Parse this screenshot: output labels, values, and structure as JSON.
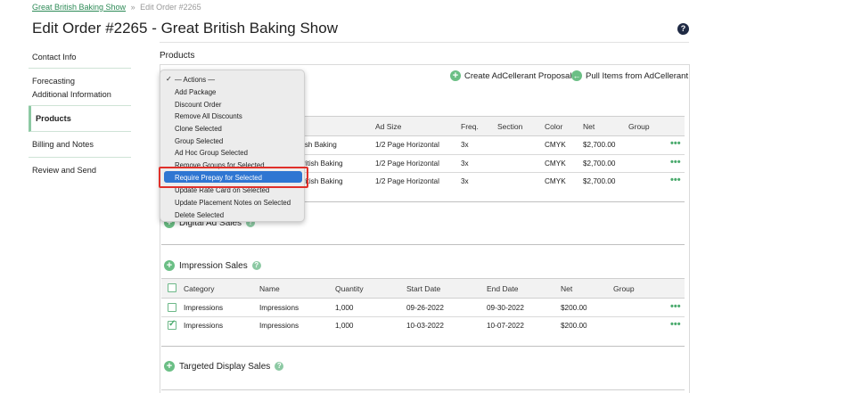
{
  "breadcrumb": {
    "link": "Great British Baking Show",
    "separator": "»",
    "current": "Edit Order #2265"
  },
  "page_title": "Edit Order #2265 - Great British Baking Show",
  "help_label": "?",
  "sidebar": {
    "items": [
      {
        "label": "Contact Info"
      },
      {
        "label": "Forecasting"
      },
      {
        "label": "Additional Information"
      },
      {
        "label": "Products"
      },
      {
        "label": "Billing and Notes"
      },
      {
        "label": "Review and Send"
      }
    ]
  },
  "products_heading": "Products",
  "top_actions": {
    "create_proposal": "Create AdCellerant Proposal",
    "pull_items": "Pull Items from AdCellerant"
  },
  "print_table": {
    "headers": [
      "Ad Size",
      "Freq.",
      "Section",
      "Color",
      "Net",
      "Group"
    ],
    "rows": [
      {
        "name_fragment": "ish Baking",
        "ad_size": "1/2 Page Horizontal",
        "freq": "3x",
        "section": "",
        "color": "CMYK",
        "net": "$2,700.00"
      },
      {
        "name_fragment": "ritish Baking",
        "ad_size": "1/2 Page Horizontal",
        "freq": "3x",
        "section": "",
        "color": "CMYK",
        "net": "$2,700.00"
      },
      {
        "name_fragment": "ritish Baking",
        "ad_size": "1/2 Page Horizontal",
        "freq": "3x",
        "section": "",
        "color": "CMYK",
        "net": "$2,700.00"
      }
    ]
  },
  "digital_section_title": "Digital Ad Sales",
  "impression_section": {
    "title": "Impression Sales",
    "headers": [
      "Category",
      "Name",
      "Quantity",
      "Start Date",
      "End Date",
      "Net",
      "Group"
    ],
    "rows": [
      {
        "checked": false,
        "category": "Impressions",
        "name": "Impressions",
        "quantity": "1,000",
        "start": "09-26-2022",
        "end": "09-30-2022",
        "net": "$200.00"
      },
      {
        "checked": true,
        "category": "Impressions",
        "name": "Impressions",
        "quantity": "1,000",
        "start": "10-03-2022",
        "end": "10-07-2022",
        "net": "$200.00"
      }
    ]
  },
  "targeted_section_title": "Targeted Display Sales",
  "row_menu_glyph": "•••",
  "actions_menu": {
    "checkmark": "✓",
    "items": [
      "— Actions —",
      "Add Package",
      "Discount Order",
      "Remove All Discounts",
      "Clone Selected",
      "Group Selected",
      "Ad Hoc Group Selected",
      "Remove Groups for Selected",
      "Require Prepay for Selected",
      "Update Rate Card on Selected",
      "Update Placement Notes on Selected",
      "Delete Selected"
    ],
    "highlighted_index": 8
  },
  "colors": {
    "accent_green": "#6bbf85",
    "link_green": "#2e8b57",
    "highlight_blue": "#2f76d2",
    "annotation_red": "#e0302a"
  }
}
